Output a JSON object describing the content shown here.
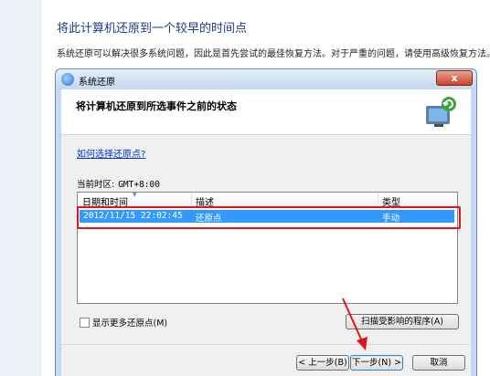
{
  "page": {
    "title": "将此计算机还原到一个较早的时间点",
    "description": "系统还原可以解决很多系统问题，因此是首先尝试的最佳恢复方法。对于严重的问题，请使用高级恢复方法。"
  },
  "window": {
    "title": "系统还原",
    "close_label": "x"
  },
  "dialog": {
    "heading": "将计算机还原到所选事件之前的状态",
    "help_link": "如何选择还原点?",
    "timezone_label": "当前时区:",
    "timezone_value": "GMT+8:00",
    "columns": [
      "日期和时间",
      "描述",
      "类型"
    ],
    "rows": [
      {
        "datetime": "2012/11/15 22:02:45",
        "description": "还原点",
        "type": "手动",
        "selected": true
      }
    ],
    "show_more_label": "显示更多还原点(M)",
    "scan_button": "扫描受影响的程序(A)",
    "back_button": "< 上一步(B)",
    "next_button": "下一步(N) >",
    "cancel_button": "取消"
  },
  "colors": {
    "selection": "#3399ff",
    "annotation": "#e0141e",
    "title_blue": "#1e3d8a"
  },
  "icons": {
    "window_icon": "system-restore-icon",
    "header_icon": "computer-restore-icon"
  }
}
